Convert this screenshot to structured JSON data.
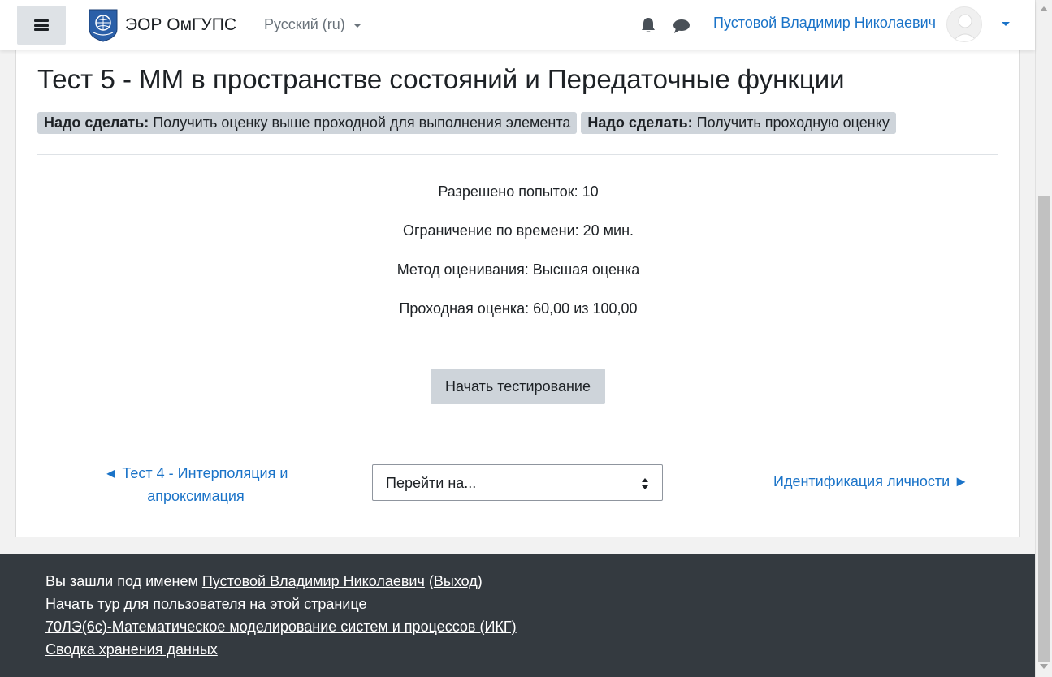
{
  "header": {
    "brand_name": "ЭОР ОмГУПС",
    "language": "Русский (ru)",
    "user_name": "Пустовой Владимир Николаевич",
    "icons": [
      "menu-icon",
      "university-logo",
      "bell-icon",
      "chat-icon",
      "user-avatar",
      "chevron-down-icon"
    ]
  },
  "main": {
    "title": "Тест 5 - ММ в пространстве состояний и Передаточные функции",
    "completion": [
      {
        "label": "Надо сделать:",
        "text": "Получить оценку выше проходной для выполнения элемента"
      },
      {
        "label": "Надо сделать:",
        "text": "Получить проходную оценку"
      }
    ],
    "info": [
      "Разрешено попыток: 10",
      "Ограничение по времени: 20 мин.",
      "Метод оценивания: Высшая оценка",
      "Проходная оценка: 60,00 из 100,00"
    ],
    "start_button": "Начать тестирование",
    "prev_link": {
      "line1": "◄ Тест 4 - Интерполяция и",
      "line2": "апроксимация"
    },
    "jump_select": "Перейти на...",
    "next_link": "Идентификация личности ►"
  },
  "footer": {
    "logged_in_prefix": "Вы зашли под именем",
    "user_link": "Пустовой Владимир Николаевич",
    "logout_open": "(",
    "logout_link": "Выход",
    "logout_close": ")",
    "tour_link": "Начать тур для пользователя на этой странице",
    "course_link": "70ЛЭ(6с)-Математическое моделирование систем и процессов (ИКГ)",
    "data_link": "Сводка хранения данных"
  },
  "colors": {
    "link": "#1a73c8",
    "badge_bg": "#ced4da",
    "footer_bg": "#343a40",
    "button_bg": "#ced4da"
  }
}
